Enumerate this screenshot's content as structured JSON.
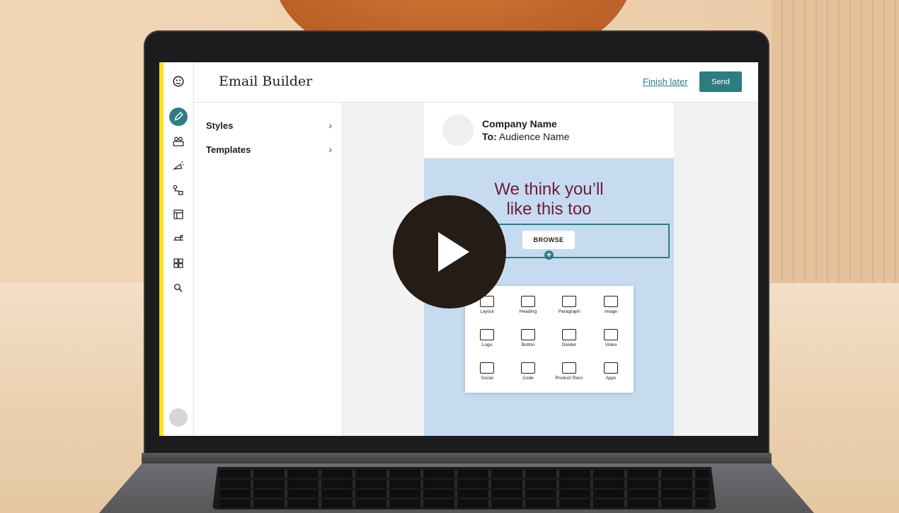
{
  "app": {
    "title": "Email Builder",
    "finish_later": "Finish later",
    "send": "Send"
  },
  "rail": {
    "icons": [
      "mailchimp-logo-icon",
      "pencil-icon",
      "audience-icon",
      "campaigns-icon",
      "automations-icon",
      "website-icon",
      "integrations-icon",
      "content-icon",
      "search-icon"
    ]
  },
  "panel": {
    "items": [
      {
        "label": "Styles"
      },
      {
        "label": "Templates"
      }
    ]
  },
  "email": {
    "company": "Company Name",
    "to_label": "To:",
    "audience": "Audience Name",
    "headline_line1": "We think you’ll",
    "headline_line2": "like this too",
    "button": "BROWSE",
    "add": "+"
  },
  "blocks": [
    {
      "label": "Layout",
      "icon": "layout-icon"
    },
    {
      "label": "Heading",
      "icon": "heading-icon"
    },
    {
      "label": "Paragraph",
      "icon": "paragraph-icon"
    },
    {
      "label": "Image",
      "icon": "image-icon"
    },
    {
      "label": "Logo",
      "icon": "logo-icon"
    },
    {
      "label": "Button",
      "icon": "button-icon"
    },
    {
      "label": "Divider",
      "icon": "divider-icon"
    },
    {
      "label": "Video",
      "icon": "video-icon"
    },
    {
      "label": "Social",
      "icon": "social-icon"
    },
    {
      "label": "Code",
      "icon": "code-icon"
    },
    {
      "label": "Product Recs",
      "icon": "product-recs-icon"
    },
    {
      "label": "Apps",
      "icon": "apps-icon"
    }
  ],
  "colors": {
    "accent": "#2e7c82",
    "brand_yellow": "#ffe01b",
    "headline": "#6b1d3a",
    "email_bg": "#c6dbf0",
    "play": "#241c15"
  }
}
